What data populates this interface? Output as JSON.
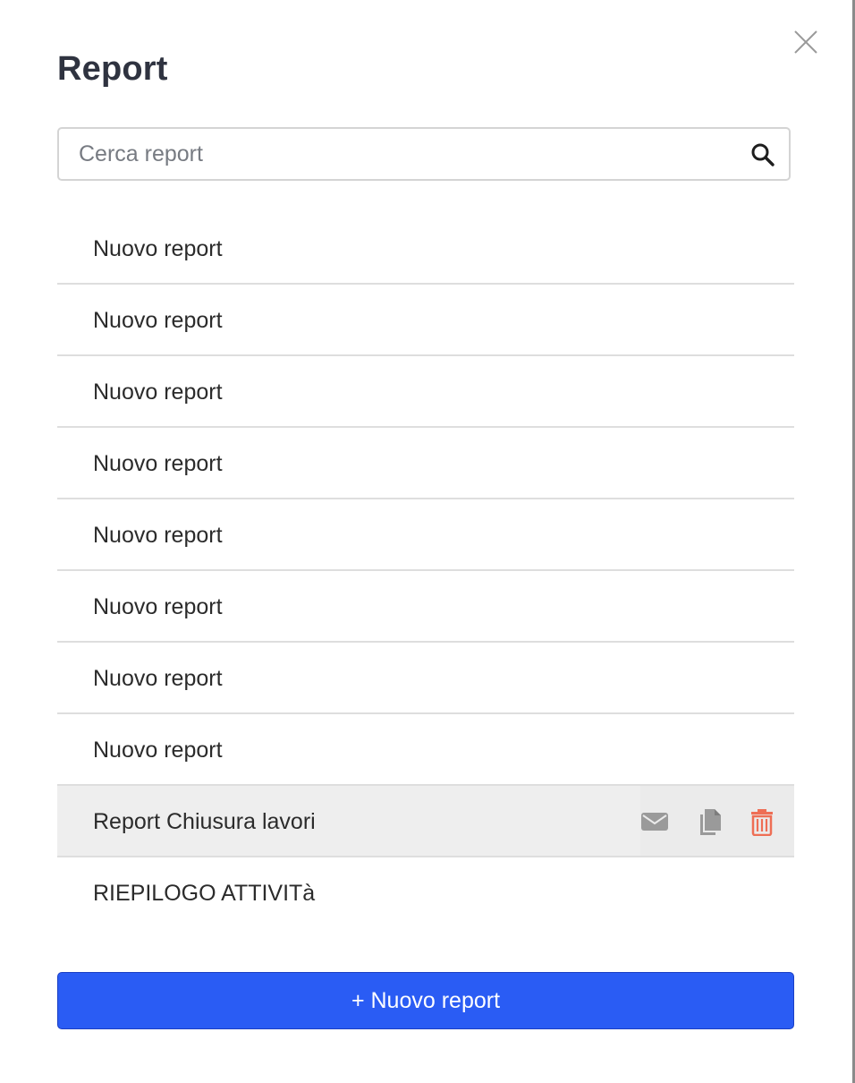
{
  "modal": {
    "title": "Report",
    "close_icon": "close-icon"
  },
  "search": {
    "placeholder": "Cerca report",
    "value": "",
    "icon": "search-icon"
  },
  "reports": [
    {
      "label": "Nuovo report"
    },
    {
      "label": "Nuovo report"
    },
    {
      "label": "Nuovo report"
    },
    {
      "label": "Nuovo report"
    },
    {
      "label": "Nuovo report"
    },
    {
      "label": "Nuovo report"
    },
    {
      "label": "Nuovo report"
    },
    {
      "label": "Nuovo report"
    },
    {
      "label": "Report Chiusura lavori",
      "hovered": true,
      "actions": [
        "email-icon",
        "copy-icon",
        "trash-icon"
      ]
    },
    {
      "label": "RIEPILOGO ATTIVITà"
    }
  ],
  "footer": {
    "new_report_label": "+ Nuovo report"
  },
  "colors": {
    "primary": "#2a5cf4",
    "danger": "#ee6e55",
    "action_icon": "#9a9a9a",
    "hover_row": "#eeeeee",
    "title": "#2f3340"
  }
}
